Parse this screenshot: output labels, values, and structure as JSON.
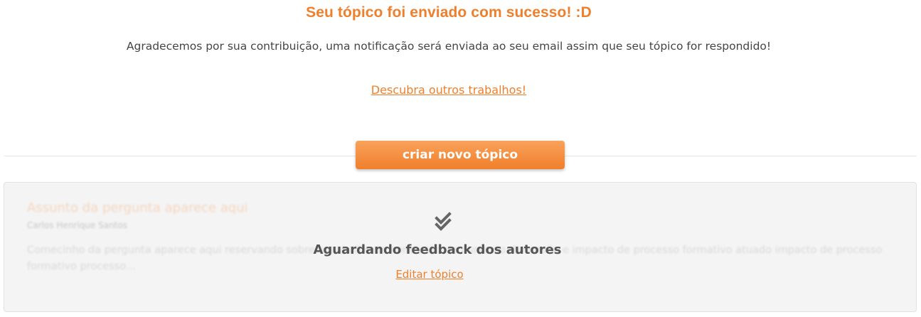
{
  "success": {
    "title": "Seu tópico foi enviado com sucesso! :D",
    "message": "Agradecemos por sua contribuição, uma notificação será enviada ao seu email assim que seu tópico for respondido!",
    "discover_link": "Descubra outros trabalhos!"
  },
  "actions": {
    "new_topic_label": "criar novo tópico"
  },
  "topic_card": {
    "title": "Assunto da pergunta aparece aqui",
    "author": "Carlos Henrique Santos",
    "excerpt": "Comecinho da pergunta aparece aqui reservando sobre o trabalho de conclusão de curso do dimensão e impacto de processo formativo atuado impacto de processo formativo processo...",
    "status": "Aguardando feedback dos autores",
    "edit_link": "Editar tópico",
    "status_icon": "double-check-icon"
  },
  "colors": {
    "accent": "#f07f2c",
    "card_background": "#f4f4f4",
    "status_text": "#555555"
  }
}
